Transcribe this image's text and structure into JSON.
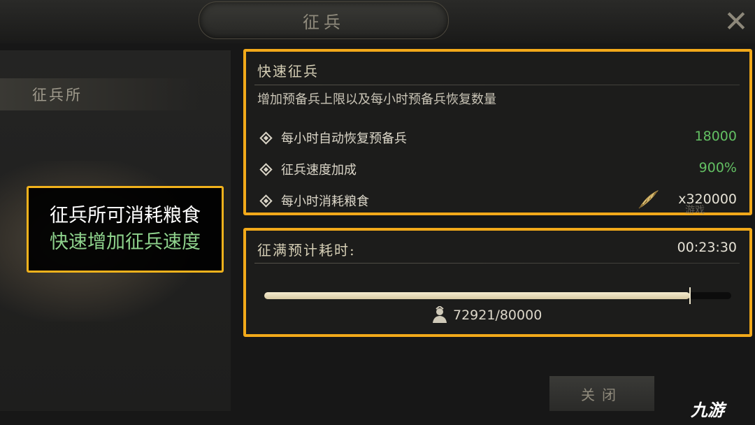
{
  "header": {
    "title": "征兵"
  },
  "left": {
    "tab_label": "征兵所"
  },
  "callout": {
    "line1": "征兵所可消耗粮食",
    "line2": "快速增加征兵速度"
  },
  "quick_recruit": {
    "title": "快速征兵",
    "description": "增加预备兵上限以及每小时预备兵恢复数量",
    "rows": [
      {
        "label": "每小时自动恢复预备兵",
        "value": "18000"
      },
      {
        "label": "征兵速度加成",
        "value": "900%"
      },
      {
        "label": "每小时消耗粮食",
        "value": "x320000",
        "icon": "grain-icon"
      }
    ],
    "accent_color": "#f2a91a",
    "value_color": "#63c063"
  },
  "timer": {
    "label": "征满预计耗时:",
    "value": "00:23:30",
    "count_text": "72921/80000",
    "progress": 0.9115
  },
  "footer": {
    "close_label": "关闭"
  },
  "watermarks": {
    "mid": "游戏",
    "logo": "九游"
  }
}
